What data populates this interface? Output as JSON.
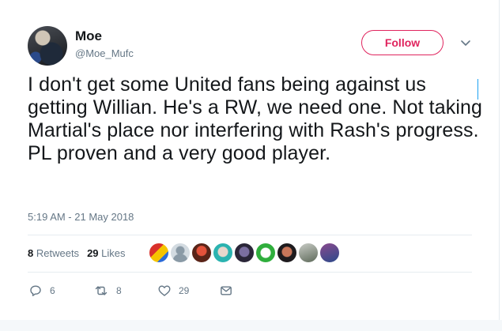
{
  "tweet": {
    "name": "Moe",
    "handle": "@Moe_Mufc",
    "follow_label": "Follow",
    "text": "I don't get some United fans being against us getting Willian. He's a RW, we need one. Not taking Martial's place nor interfering with Rash's progress. PL proven and a very good player.",
    "timestamp": "5:19 AM - 21 May 2018",
    "retweets_count": "8",
    "retweets_label": "Retweets",
    "likes_count": "29",
    "likes_label": "Likes",
    "reply_count": "6",
    "retweet_action_count": "8",
    "like_action_count": "29"
  },
  "colors": {
    "accent": "#e0245e",
    "muted": "#657786",
    "text": "#14171a",
    "divider": "#e6ecf0"
  },
  "icons": [
    "chevron-down-icon",
    "reply-icon",
    "retweet-icon",
    "heart-icon",
    "envelope-icon"
  ]
}
